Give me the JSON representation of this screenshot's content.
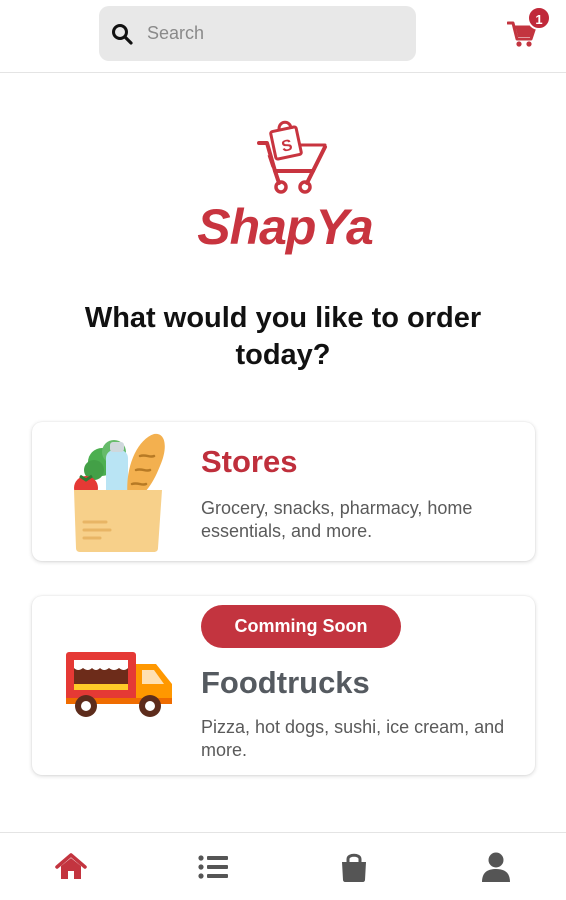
{
  "search": {
    "placeholder": "Search"
  },
  "cart": {
    "count": "1"
  },
  "logo": {
    "text": "ShapYa"
  },
  "main": {
    "question": "What would you like to order today?"
  },
  "categories": [
    {
      "title": "Stores",
      "description": "Grocery, snacks, pharmacy, home essentials, and more.",
      "icon": "grocery-bag-icon"
    },
    {
      "badge": "Comming Soon",
      "title": "Foodtrucks",
      "description": "Pizza, hot dogs, sushi, ice cream, and more.",
      "icon": "food-truck-icon"
    }
  ],
  "bottom_nav": [
    {
      "icon": "home-icon",
      "active": true
    },
    {
      "icon": "list-icon",
      "active": false
    },
    {
      "icon": "shopping-bag-icon",
      "active": false
    },
    {
      "icon": "user-icon",
      "active": false
    }
  ],
  "colors": {
    "brand": "#c8343f",
    "inactive_icon": "#555555",
    "muted_title": "#555a60"
  }
}
